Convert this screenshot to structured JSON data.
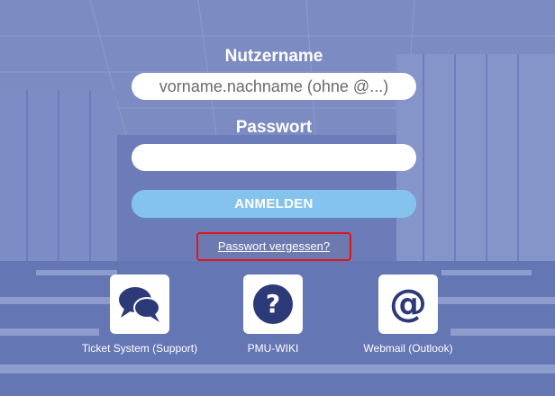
{
  "login": {
    "username_label": "Nutzername",
    "username_placeholder": "vorname.nachname (ohne @...)",
    "password_label": "Passwort",
    "password_value": "",
    "login_button": "ANMELDEN",
    "forgot_password": "Passwort vergessen?"
  },
  "quick_links": [
    {
      "label": "Ticket System (Support)",
      "icon": "chat-bubbles-icon"
    },
    {
      "label": "PMU-WIKI",
      "icon": "question-circle-icon"
    },
    {
      "label": "Webmail (Outlook)",
      "icon": "at-sign-icon"
    }
  ],
  "colors": {
    "accent_button": "#84c3ee",
    "icon": "#2c3a78",
    "highlight_border": "#e0141a"
  }
}
